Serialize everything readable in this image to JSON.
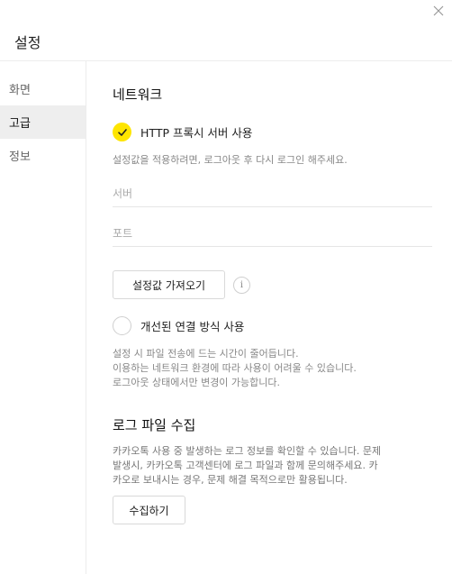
{
  "window": {
    "title": "설정"
  },
  "sidebar": {
    "items": [
      {
        "label": "화면"
      },
      {
        "label": "고급"
      },
      {
        "label": "정보"
      }
    ]
  },
  "network": {
    "title": "네트워크",
    "proxy_label": "HTTP 프록시 서버 사용",
    "proxy_checked": true,
    "proxy_desc": "설정값을 적용하려면, 로그아웃 후 다시 로그인 해주세요.",
    "server_placeholder": "서버",
    "port_placeholder": "포트",
    "import_button": "설정값 가져오기",
    "info_icon": "i",
    "improved_label": "개선된 연결 방식 사용",
    "improved_checked": false,
    "improved_desc": [
      "설정 시 파일 전송에 드는 시간이 줄어듭니다.",
      "이용하는 네트워크 환경에 따라 사용이 어려울 수 있습니다.",
      "로그아웃 상태에서만 변경이 가능합니다."
    ]
  },
  "log": {
    "title": "로그 파일 수집",
    "desc": [
      "카카오톡 사용 중 발생하는 로그 정보를 확인할 수 있습니다. 문제",
      "발생시, 카카오톡 고객센터에 로그 파일과 함께 문의해주세요. 카",
      "카오로 보내시는 경우, 문제 해결 목적으로만 활용됩니다."
    ],
    "collect_button": "수집하기"
  },
  "colors": {
    "accent": "#fee500",
    "active_bg": "#eeeeee"
  }
}
